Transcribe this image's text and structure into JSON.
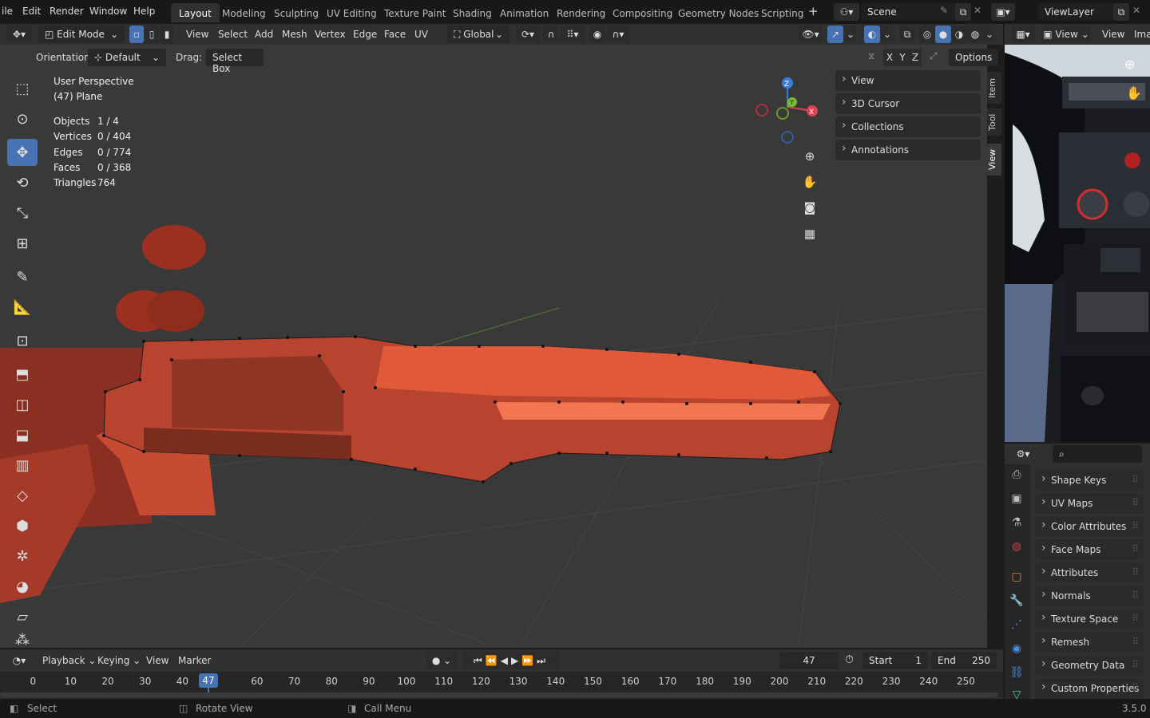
{
  "topbar": {
    "menus": [
      "ile",
      "Edit",
      "Render",
      "Window",
      "Help"
    ],
    "workspaces": [
      "Layout",
      "Modeling",
      "Sculpting",
      "UV Editing",
      "Texture Paint",
      "Shading",
      "Animation",
      "Rendering",
      "Compositing",
      "Geometry Nodes",
      "Scripting"
    ],
    "add_tab": "+",
    "scene": "Scene",
    "view_layer": "ViewLayer"
  },
  "viewport_header": {
    "mode": "Edit Mode",
    "menus": [
      "View",
      "Select",
      "Add",
      "Mesh",
      "Vertex",
      "Edge",
      "Face",
      "UV"
    ],
    "transform_orientation": "Global",
    "orientation_label": "Orientation:",
    "orientation_value": "Default",
    "drag_label": "Drag:",
    "drag_value": "Select Box",
    "axes": [
      "X",
      "Y",
      "Z"
    ],
    "options": "Options"
  },
  "overlay": {
    "perspective": "User Perspective",
    "object": "(47) Plane",
    "stats": [
      {
        "label": "Objects",
        "value": "1 / 4"
      },
      {
        "label": "Vertices",
        "value": "0 / 404"
      },
      {
        "label": "Edges",
        "value": "0 / 774"
      },
      {
        "label": "Faces",
        "value": "0 / 368"
      },
      {
        "label": "Triangles",
        "value": "764"
      }
    ]
  },
  "gizmo": {
    "x": "X",
    "y": "Y",
    "z": "Z"
  },
  "npanel": {
    "sections": [
      "View",
      "3D Cursor",
      "Collections",
      "Annotations"
    ],
    "tabs": [
      "Item",
      "Tool",
      "View"
    ]
  },
  "image_editor": {
    "view": "View",
    "view2": "View",
    "ima": "Ima"
  },
  "properties": {
    "search_placeholder": "",
    "sections": [
      "Shape Keys",
      "UV Maps",
      "Color Attributes",
      "Face Maps",
      "Attributes",
      "Normals",
      "Texture Space",
      "Remesh",
      "Geometry Data",
      "Custom Properties"
    ]
  },
  "timeline": {
    "menus": [
      "Playback",
      "Keying",
      "View",
      "Marker"
    ],
    "current_frame": "47",
    "start_label": "Start",
    "start": "1",
    "end_label": "End",
    "end": "250",
    "ticks": [
      "0",
      "10",
      "20",
      "30",
      "40",
      "50",
      "60",
      "70",
      "80",
      "90",
      "100",
      "110",
      "120",
      "130",
      "140",
      "150",
      "160",
      "170",
      "180",
      "190",
      "200",
      "210",
      "220",
      "230",
      "240",
      "250"
    ],
    "playhead": "47"
  },
  "statusbar": {
    "select": "Select",
    "rotate": "Rotate View",
    "call_menu": "Call Menu",
    "version": "3.5.0"
  },
  "colors": {
    "accent": "#4772b3",
    "mesh": "#e05a3a",
    "bg": "#393939"
  }
}
